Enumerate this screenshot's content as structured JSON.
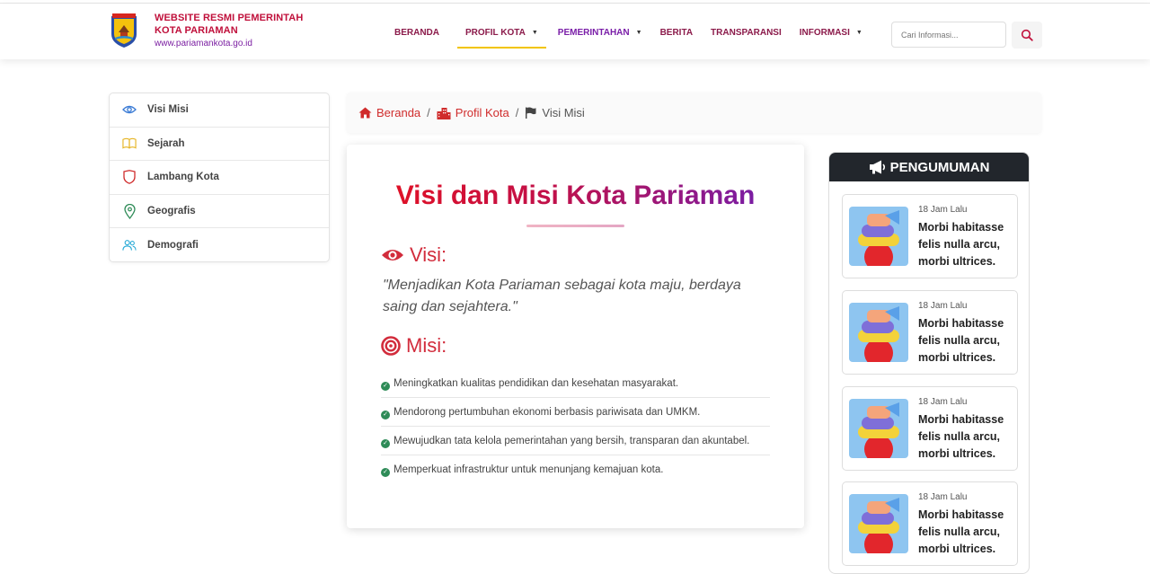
{
  "header": {
    "brand_line1": "WEBSITE RESMI PEMERINTAH",
    "brand_line2": "KOTA PARIAMAN",
    "brand_url": "www.pariamankota.go.id",
    "nav": [
      {
        "label": "BERANDA",
        "dropdown": false
      },
      {
        "label": "PROFIL KOTA",
        "dropdown": true,
        "active": true
      },
      {
        "label": "PEMERINTAHAN",
        "dropdown": true
      },
      {
        "label": "BERITA",
        "dropdown": false
      },
      {
        "label": "TRANSPARANSI",
        "dropdown": false
      },
      {
        "label": "INFORMASI",
        "dropdown": true
      }
    ],
    "search_placeholder": "Cari Informasi..."
  },
  "sidebar": {
    "items": [
      {
        "label": "Visi Misi",
        "icon": "eye-icon"
      },
      {
        "label": "Sejarah",
        "icon": "book-icon"
      },
      {
        "label": "Lambang Kota",
        "icon": "shield-icon"
      },
      {
        "label": "Geografis",
        "icon": "map-pin-icon"
      },
      {
        "label": "Demografi",
        "icon": "people-icon"
      }
    ]
  },
  "breadcrumb": {
    "home": "Beranda",
    "parent": "Profil Kota",
    "current": "Visi Misi"
  },
  "content": {
    "title": "Visi dan Misi Kota Pariaman",
    "visi_heading": "Visi:",
    "visi_text": "\"Menjadikan Kota Pariaman sebagai kota maju, berdaya saing dan sejahtera.\"",
    "misi_heading": "Misi:",
    "misi": [
      "Meningkatkan kualitas pendidikan dan kesehatan masyarakat.",
      "Mendorong pertumbuhan ekonomi berbasis pariwisata dan UMKM.",
      "Mewujudkan tata kelola pemerintahan yang bersih, transparan dan akuntabel.",
      "Memperkuat infrastruktur untuk menunjang kemajuan kota."
    ]
  },
  "announcements": {
    "heading": "PENGUMUMAN",
    "items": [
      {
        "time": "18 Jam Lalu",
        "title": "Morbi habitasse felis nulla arcu, morbi ultrices."
      },
      {
        "time": "18 Jam Lalu",
        "title": "Morbi habitasse felis nulla arcu, morbi ultrices."
      },
      {
        "time": "18 Jam Lalu",
        "title": "Morbi habitasse felis nulla arcu, morbi ultrices."
      },
      {
        "time": "18 Jam Lalu",
        "title": "Morbi habitasse felis nulla arcu, morbi ultrices."
      }
    ]
  },
  "colors": {
    "primary_red": "#d02c2c",
    "brand_purple": "#7b1fa2",
    "nav_active_underline": "#f2c400",
    "announcement_header": "#22262c",
    "check_green": "#2e8b57"
  }
}
